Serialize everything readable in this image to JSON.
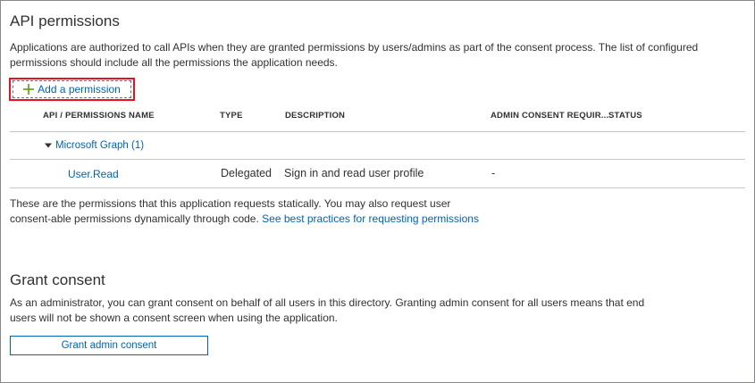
{
  "api_permissions": {
    "title": "API permissions",
    "description": "Applications are authorized to call APIs when they are granted permissions by users/admins as part of the consent process. The list of configured permissions should include all the permissions the application needs.",
    "add_permission_label": "Add a permission",
    "table": {
      "columns": [
        "API / PERMISSIONS NAME",
        "TYPE",
        "DESCRIPTION",
        "ADMIN CONSENT REQUIR...",
        "STATUS"
      ],
      "groups": [
        {
          "label": "Microsoft Graph (1)",
          "expanded": true,
          "rows": [
            {
              "name": "User.Read",
              "type": "Delegated",
              "description": "Sign in and read user profile",
              "admin_consent": "-",
              "status": ""
            }
          ]
        }
      ]
    },
    "footnote_text": "These are the permissions that this application requests statically. You may also request user consent-able permissions dynamically through code.",
    "footnote_link": "See best practices for requesting permissions"
  },
  "grant_consent": {
    "title": "Grant consent",
    "description": "As an administrator, you can grant consent on behalf of all users in this directory. Granting admin consent for all users means that end users will not be shown a consent screen when using the application.",
    "button_label": "Grant admin consent"
  },
  "colors": {
    "link": "#0063b1",
    "highlight_border": "#e81123",
    "plus_icon": "#57a300",
    "text": "#323130",
    "divider": "#c8c6c4"
  },
  "icons": {
    "add": "plus-icon",
    "group_toggle": "caret-down-icon"
  }
}
